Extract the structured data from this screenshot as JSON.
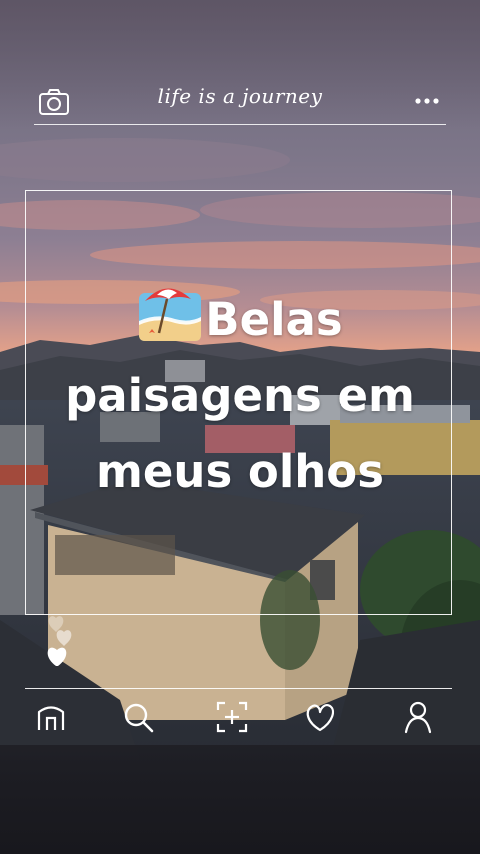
{
  "header": {
    "title": "life is a journey",
    "left_icon": "camera-icon",
    "right_icon": "more-icon"
  },
  "post": {
    "caption_line1": "Belas",
    "caption_line2": "paisagens em",
    "caption_line3": "meus olhos",
    "emoji": "beach-with-umbrella"
  },
  "nav": {
    "items": [
      {
        "icon": "home-icon"
      },
      {
        "icon": "search-icon"
      },
      {
        "icon": "add-post-icon"
      },
      {
        "icon": "heart-icon"
      },
      {
        "icon": "profile-icon"
      }
    ]
  },
  "colors": {
    "text": "#ffffff",
    "sky_top": "#6f6a80",
    "sunset": "#e99a7a"
  }
}
